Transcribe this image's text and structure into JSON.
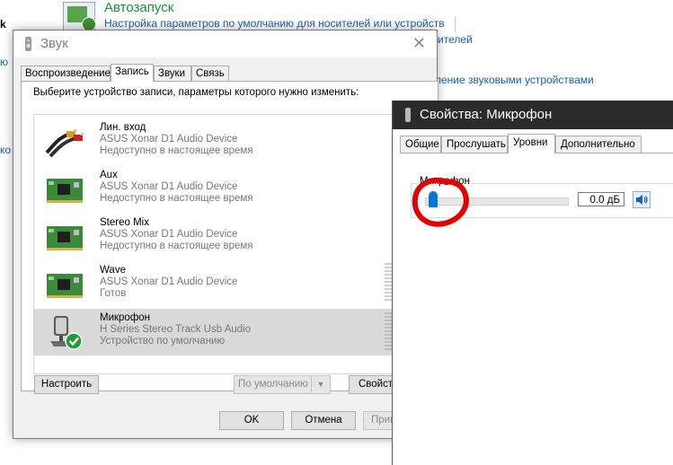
{
  "background": {
    "autorun_title": "Автозапуск",
    "autorun_link": "Настройка параметров по умолчанию для носителей или устройств",
    "link_partial_1": "ителей",
    "link_partial_2": "ление звуковыми устройствами",
    "left_chars": [
      "k",
      "ю",
      "ко"
    ]
  },
  "sound_dialog": {
    "title": "Звук",
    "close_symbol": "✕",
    "tabs": [
      "Воспроизведение",
      "Запись",
      "Звуки",
      "Связь"
    ],
    "active_tab": "Запись",
    "hint": "Выберите устройство записи, параметры которого нужно изменить:",
    "devices": [
      {
        "name": "Лин. вход",
        "driver": "ASUS Xonar D1 Audio Device",
        "status": "Недоступно в настоящее время",
        "icon": "line-in-cable-icon"
      },
      {
        "name": "Aux",
        "driver": "ASUS Xonar D1 Audio Device",
        "status": "Недоступно в настоящее время",
        "icon": "sound-card-icon"
      },
      {
        "name": "Stereo Mix",
        "driver": "ASUS Xonar D1 Audio Device",
        "status": "Недоступно в настоящее время",
        "icon": "sound-card-icon"
      },
      {
        "name": "Wave",
        "driver": "ASUS Xonar D1 Audio Device",
        "status": "Готов",
        "icon": "sound-card-icon"
      },
      {
        "name": "Микрофон",
        "driver": "H Series Stereo Track Usb Audio",
        "status": "Устройство по умолчанию",
        "icon": "microphone-icon"
      }
    ],
    "buttons": {
      "configure": "Настроить",
      "set_default": "По умолчанию",
      "properties": "Свойства",
      "ok": "OK",
      "cancel": "Отмена",
      "apply": "Применить"
    }
  },
  "mic_dialog": {
    "title": "Свойства: Микрофон",
    "tabs": [
      "Общие",
      "Прослушать",
      "Уровни",
      "Дополнительно"
    ],
    "active_tab": "Уровни",
    "group_label": "Микрофон",
    "level_value": "0.0 дБ",
    "level_fraction": 0.0
  },
  "colors": {
    "accent": "#0078d7",
    "link": "#1a5fb4",
    "autorun_green": "#1a8f3c",
    "annotation_red": "#e00000",
    "titlebar_dark": "#2b2b2b"
  }
}
